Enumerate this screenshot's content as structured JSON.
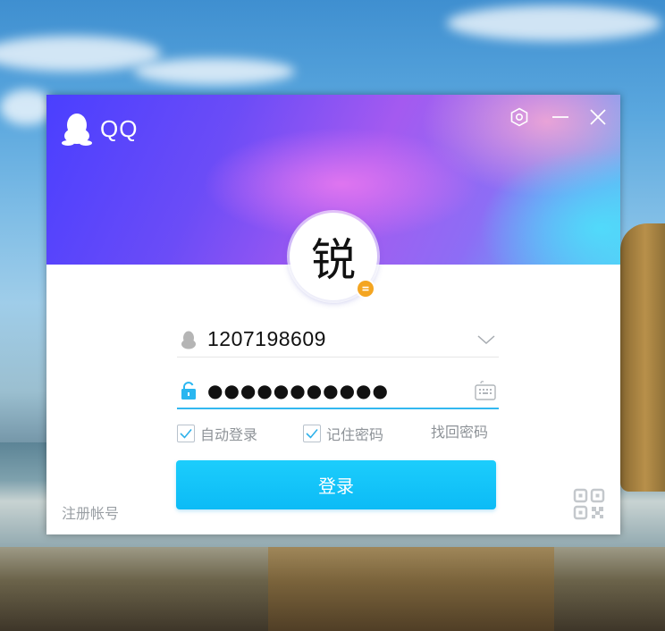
{
  "window": {
    "brand": "QQ",
    "controls": {
      "settings": "settings-icon",
      "minimize": "minimize-icon",
      "close": "close-icon"
    }
  },
  "avatar": {
    "char": "锐",
    "status": "away"
  },
  "account": {
    "value": "1207198609"
  },
  "password": {
    "masked_value": "●●●●●●●●●●●"
  },
  "options": {
    "auto_login": {
      "label": "自动登录",
      "checked": true
    },
    "remember_password": {
      "label": "记住密码",
      "checked": true
    },
    "find_password": "找回密码"
  },
  "login_button": "登录",
  "register": "注册帐号",
  "colors": {
    "accent": "#12c3fa",
    "status": "#f4a521",
    "focus_line": "#33b8f0"
  }
}
